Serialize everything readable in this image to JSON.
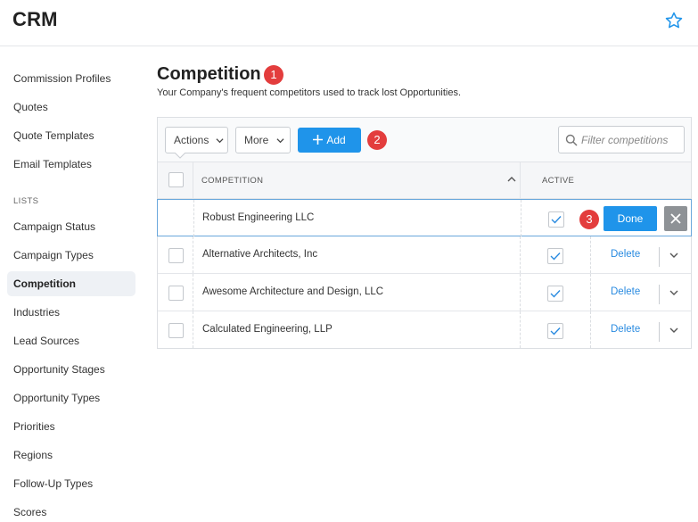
{
  "app": {
    "title": "CRM"
  },
  "sidebar": {
    "items_top": [
      "Commission Profiles",
      "Quotes",
      "Quote Templates",
      "Email Templates"
    ],
    "section_label": "LISTS",
    "items_lists": [
      "Campaign Status",
      "Campaign Types",
      "Competition",
      "Industries",
      "Lead Sources",
      "Opportunity Stages",
      "Opportunity Types",
      "Priorities",
      "Regions",
      "Follow-Up Types",
      "Scores"
    ],
    "active_item": "Competition"
  },
  "page": {
    "title": "Competition",
    "description": "Your Company's frequent competitors used to track lost Opportunities."
  },
  "badges": [
    "1",
    "2",
    "3"
  ],
  "toolbar": {
    "actions_label": "Actions",
    "more_label": "More",
    "add_label": "Add",
    "filter_placeholder": "Filter competitions"
  },
  "table": {
    "columns": {
      "competition": "COMPETITION",
      "active": "ACTIVE"
    },
    "rows": [
      {
        "name": "Robust Engineering LLC",
        "active": true,
        "editing": true
      },
      {
        "name": "Alternative Architects, Inc",
        "active": true
      },
      {
        "name": "Awesome Architecture and Design, LLC",
        "active": true
      },
      {
        "name": "Calculated Engineering, LLP",
        "active": true
      }
    ],
    "done_label": "Done",
    "delete_label": "Delete"
  },
  "colors": {
    "accent": "#1f94ea",
    "badge": "#e33d3d",
    "close_button": "#8e9296"
  }
}
